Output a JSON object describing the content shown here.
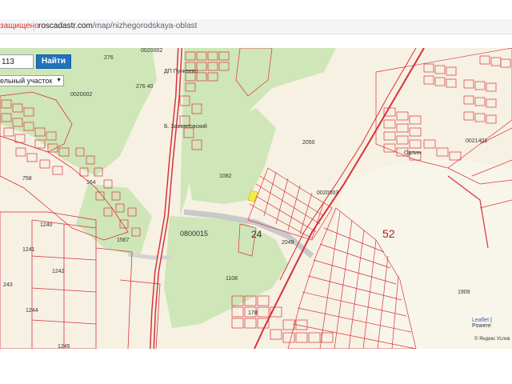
{
  "urlbar": {
    "warning": "защищено",
    "host": "roscadastr.com",
    "path": "/map/nizhegorodskaya-oblast"
  },
  "search": {
    "value": "113",
    "button_label": "Найти",
    "select_value": "ельный участок"
  },
  "map": {
    "labels": {
      "l276a": "276",
      "l0020002a": "0020002",
      "l0020002b": "0020002",
      "l276b": "276 40",
      "l_dp": "ДП Пучкеево",
      "l_bzav": "Б. Завьяловский",
      "l2050": "2050",
      "l1082": "1082",
      "l0020003": "0020003",
      "l0021401": "0021401",
      "l_orl": "Орлин",
      "l1240": "1240",
      "l1241": "1241",
      "l1242": "1242",
      "l243": "243",
      "l1244": "1244",
      "l0800015": "0800015",
      "l24": "24",
      "l52": "52",
      "l1108": "1108",
      "l1909": "1909",
      "l164": "164",
      "l758": "758",
      "l1567": "1567",
      "l2049": "2049",
      "l178": "178",
      "l1245": "1245"
    },
    "attribution_leaflet": "Leaflet",
    "attribution_powered": "| Powere",
    "yandex_text": "© Яндекс Услов"
  }
}
